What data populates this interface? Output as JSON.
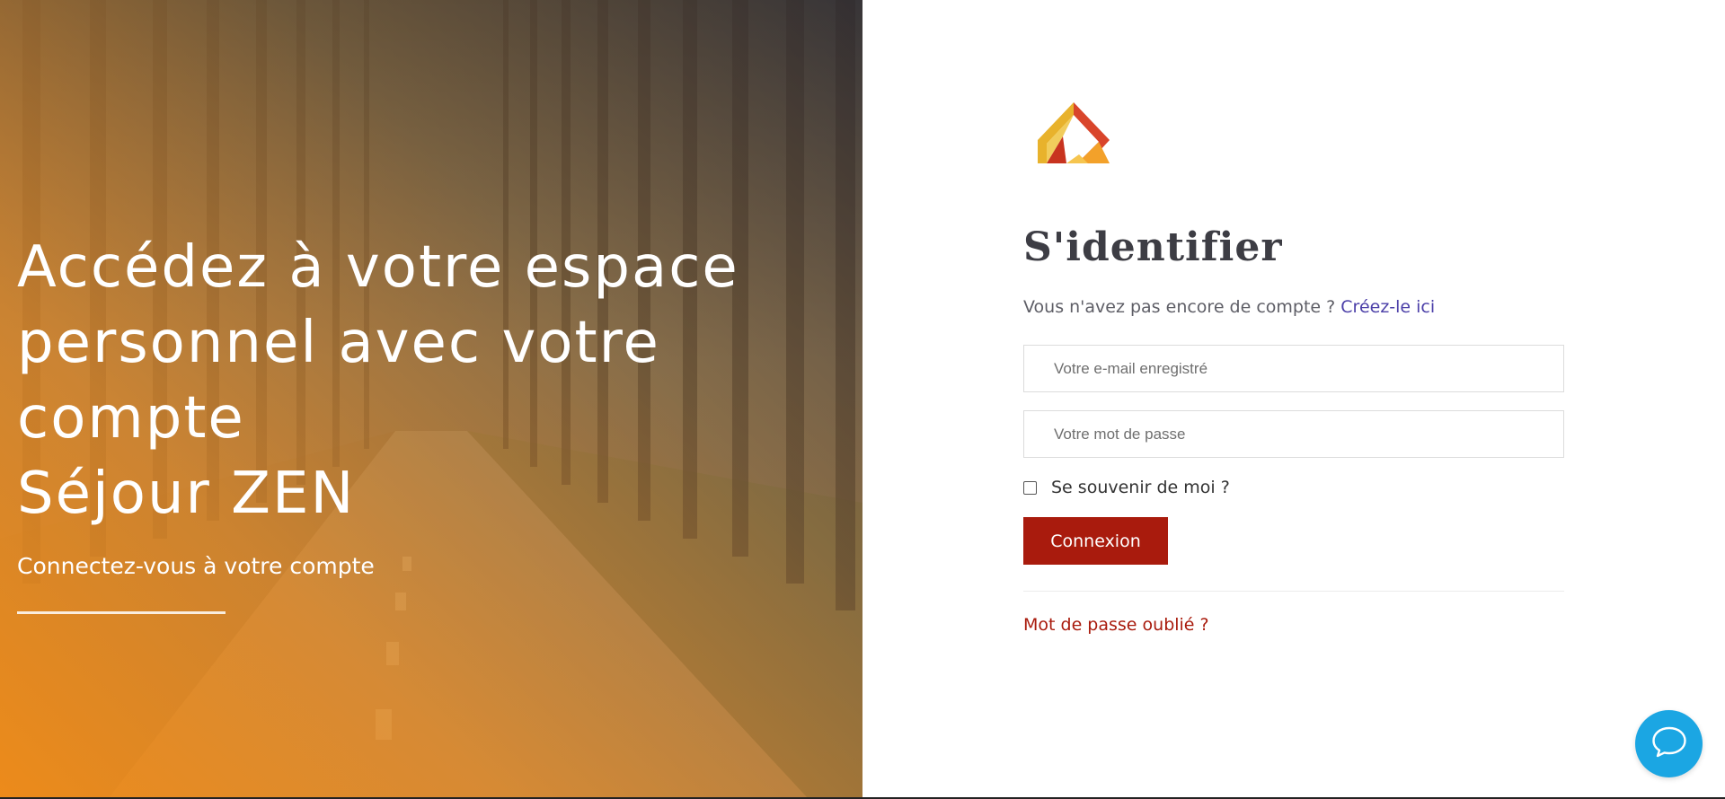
{
  "hero": {
    "title_line1": "Accédez à votre espace",
    "title_line2": "personnel avec votre compte",
    "title_line3": "Séjour ZEN",
    "subtitle": "Connectez-vous à votre compte"
  },
  "login": {
    "logo_icon": "house-logo-icon",
    "title": "S'identifier",
    "signup_prompt": "Vous n'avez pas encore de compte ? ",
    "signup_link": "Créez-le ici",
    "email_value": "",
    "email_placeholder": "Votre e-mail enregistré",
    "password_value": "",
    "password_placeholder": "Votre mot de passe",
    "remember_label": "Se souvenir de moi ?",
    "remember_checked": false,
    "submit_label": "Connexion",
    "forgot_link": "Mot de passe oublié ?"
  },
  "chat": {
    "icon": "chat-bubble-icon"
  },
  "colors": {
    "accent_red": "#a91b0d",
    "link_purple": "#4b3fa8",
    "chat_blue": "#1ba6e3",
    "hero_orange": "#f08c19"
  }
}
